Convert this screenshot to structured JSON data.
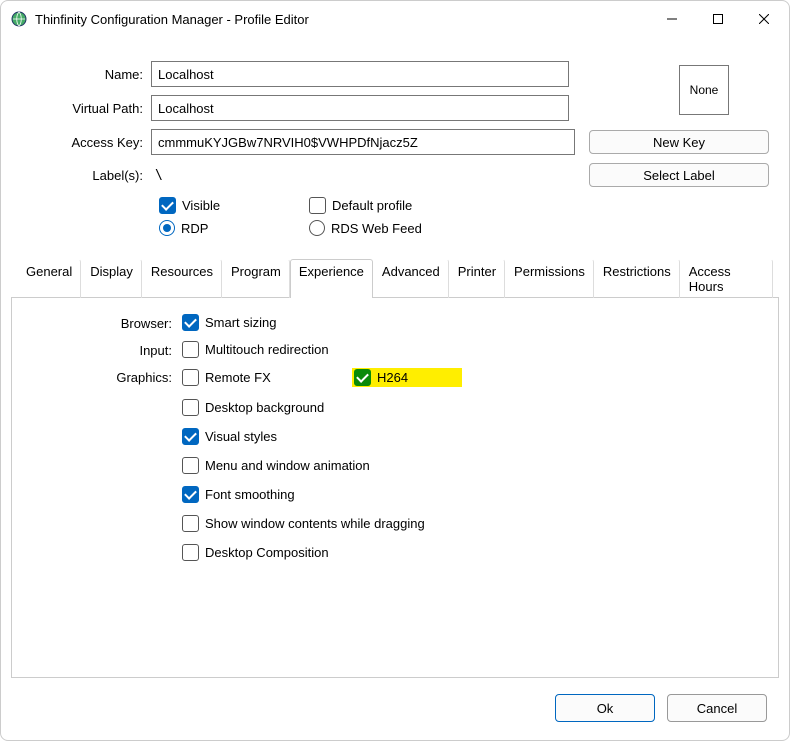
{
  "window": {
    "title": "Thinfinity Configuration Manager - Profile Editor",
    "thumb_label": "None"
  },
  "fields": {
    "name_label": "Name:",
    "name_value": "Localhost",
    "vpath_label": "Virtual Path:",
    "vpath_value": "Localhost",
    "akey_label": "Access Key:",
    "akey_value": "cmmmuKYJGBw7NRVIH0$VWHPDfNjacz5Z",
    "labels_label": "Label(s):",
    "labels_value": "\\"
  },
  "buttons": {
    "new_key": "New Key",
    "select_label": "Select Label",
    "ok": "Ok",
    "cancel": "Cancel"
  },
  "topchecks": {
    "visible": "Visible",
    "default_profile": "Default profile",
    "rdp": "RDP",
    "rds": "RDS Web Feed"
  },
  "tabs": {
    "general": "General",
    "display": "Display",
    "resources": "Resources",
    "program": "Program",
    "experience": "Experience",
    "advanced": "Advanced",
    "printer": "Printer",
    "permissions": "Permissions",
    "restrictions": "Restrictions",
    "access_hours": "Access Hours"
  },
  "exp": {
    "browser_label": "Browser:",
    "smart_sizing": "Smart sizing",
    "input_label": "Input:",
    "multitouch": "Multitouch redirection",
    "graphics_label": "Graphics:",
    "remotefx": "Remote FX",
    "h264": "H264",
    "desktop_bg": "Desktop background",
    "visual_styles": "Visual styles",
    "menu_anim": "Menu and window animation",
    "font_smoothing": "Font smoothing",
    "show_drag": "Show window contents while dragging",
    "desk_comp": "Desktop Composition"
  },
  "state": {
    "visible_checked": true,
    "default_profile_checked": false,
    "connection_mode": "rdp",
    "smart_sizing": true,
    "multitouch": false,
    "remotefx": false,
    "h264": true,
    "desktop_bg": false,
    "visual_styles": true,
    "menu_anim": false,
    "font_smoothing": true,
    "show_drag": false,
    "desk_comp": false,
    "active_tab": "experience"
  }
}
